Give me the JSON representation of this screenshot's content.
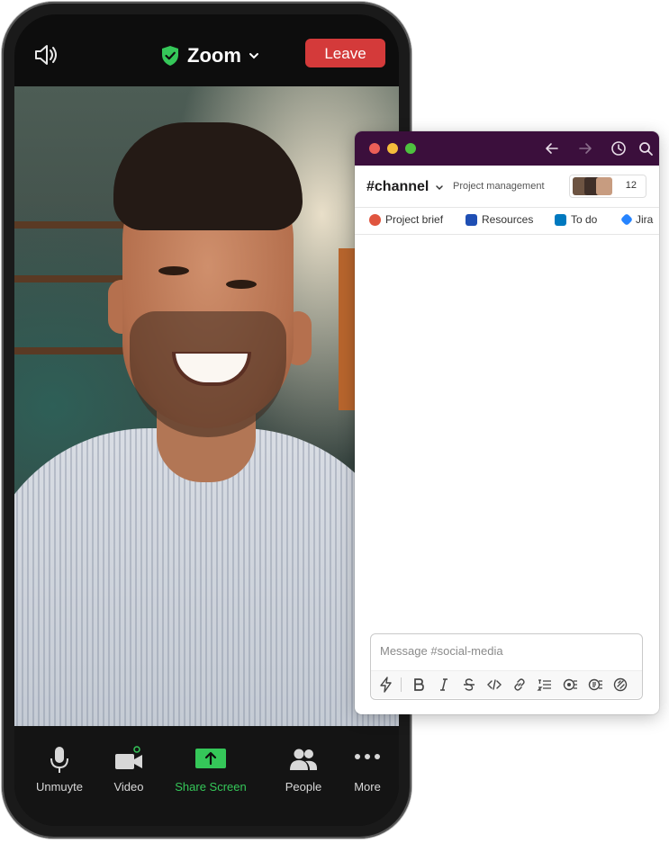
{
  "zoom": {
    "title": "Zoom",
    "leave_label": "Leave",
    "controls": [
      {
        "label": "Unmuyte",
        "icon": "microphone-icon"
      },
      {
        "label": "Video",
        "icon": "video-camera-icon"
      },
      {
        "label": "Share Screen",
        "icon": "share-screen-icon"
      },
      {
        "label": "People",
        "icon": "people-icon"
      },
      {
        "label": "More",
        "icon": "more-dots-icon"
      }
    ],
    "colors": {
      "leave": "#d43a3a",
      "share": "#35c759",
      "shield": "#35c759"
    }
  },
  "slack": {
    "channel_name": "#channel",
    "channel_topic": "Project management",
    "member_count": "12",
    "tabs": [
      {
        "label": "Project brief",
        "icon": "document-icon"
      },
      {
        "label": "Resources",
        "icon": "dropbox-icon"
      },
      {
        "label": "To do",
        "icon": "trello-icon"
      },
      {
        "label": "Jira",
        "icon": "jira-icon"
      }
    ],
    "message_placeholder": "Message #social-media",
    "colors": {
      "titlebar": "#3b0f3c"
    }
  }
}
